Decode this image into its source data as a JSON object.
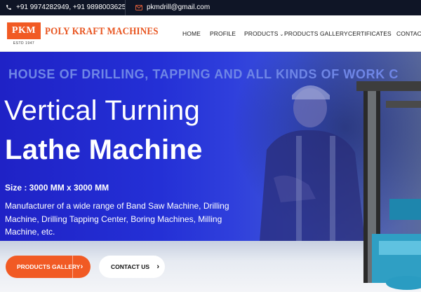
{
  "topbar": {
    "phone": "+91 9974282949, +91 9898003625",
    "email": "pkmdrill@gmail.com"
  },
  "logo": {
    "mark": "PKM",
    "estd": "ESTD 1947",
    "name": "POLY KRAFT MACHINES"
  },
  "nav": {
    "items": [
      {
        "label": "HOME"
      },
      {
        "label": "PROFILE"
      },
      {
        "label": "PRODUCTS"
      },
      {
        "label": "PRODUCTS GALLERY"
      },
      {
        "label": "CERTIFICATES"
      },
      {
        "label": "CONTACT"
      }
    ]
  },
  "hero": {
    "tagline": "HOUSE OF DRILLING, TAPPING  AND ALL KINDS OF WORK C",
    "title_line1": "Vertical Turning",
    "title_line2": "Lathe Machine",
    "size": "Size : 3000 MM x 3000 MM",
    "description": "Manufacturer of a wide range of Band Saw Machine, Drilling Machine, Drilling Tapping Center, Boring Machines, Milling Machine, etc.",
    "primary_button": "PRODUCTS GALLERY",
    "secondary_button": "CONTACT US"
  },
  "colors": {
    "accent": "#f15a24",
    "topbar": "#0f1526",
    "hero_blue": "#2430d6"
  }
}
